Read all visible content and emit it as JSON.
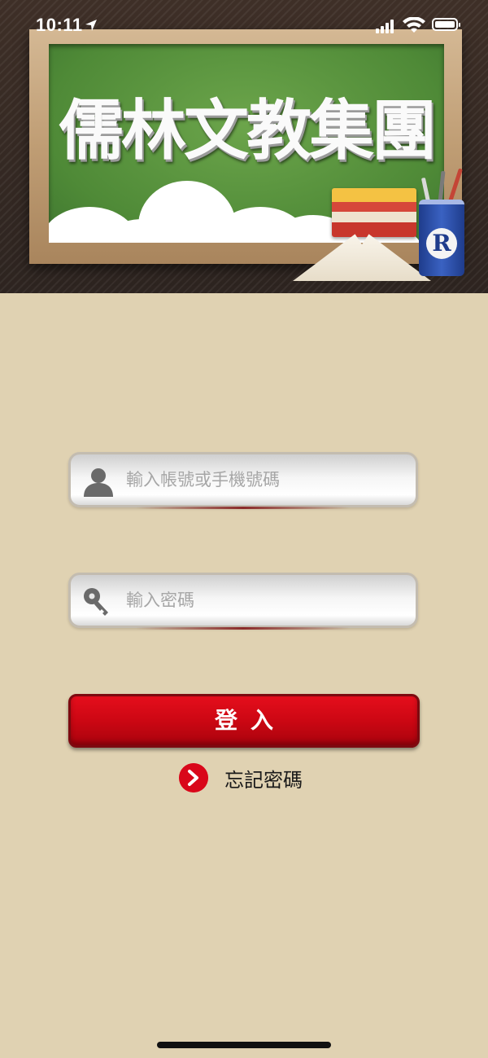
{
  "status_bar": {
    "time": "10:11"
  },
  "banner": {
    "title": "儒林文教集團",
    "logo_letter": "R"
  },
  "login_form": {
    "username_placeholder": "輸入帳號或手機號碼",
    "password_placeholder": "輸入密碼",
    "login_label": "登入",
    "forgot_password_label": "忘記密碼"
  },
  "icons": {
    "username": "user-icon",
    "password": "key-icon",
    "forgot": "chevron-right-circle-icon"
  },
  "colors": {
    "background": "#e0d2b2",
    "button_red": "#cc0713",
    "board_green": "#4f8a37"
  }
}
